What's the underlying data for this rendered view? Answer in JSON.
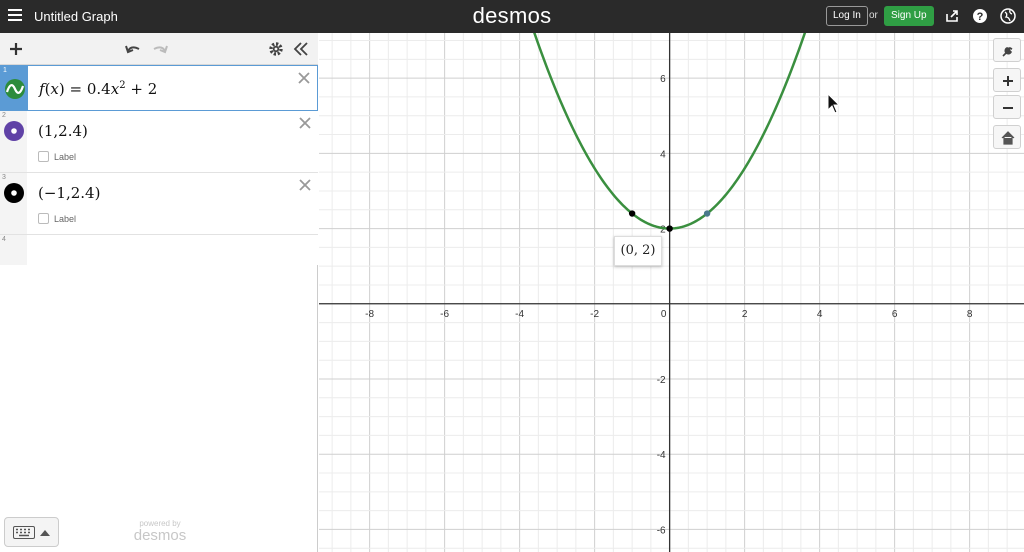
{
  "header": {
    "doc_title": "Untitled Graph",
    "brand": "desmos",
    "login_label": "Log In",
    "or_label": "or",
    "signup_label": "Sign Up",
    "icons": [
      "share-icon",
      "help-icon",
      "language-globe-icon"
    ]
  },
  "toolbar": {
    "icons": [
      "add-icon",
      "undo-icon",
      "redo-icon",
      "settings-gear-icon",
      "collapse-panel-icon"
    ]
  },
  "expressions": [
    {
      "num": "1",
      "latex_parts": {
        "fn": "f",
        "var": "x",
        "eq": "=",
        "coef": "0.4",
        "var2": "x",
        "exp": "2",
        "rest": "+ 2"
      },
      "color": "#2d8c3c",
      "type": "function"
    },
    {
      "num": "2",
      "text": "(1,2.4)",
      "color": "#6042a6",
      "type": "point",
      "label": "Label"
    },
    {
      "num": "3",
      "text": "(−1,2.4)",
      "color": "#000000",
      "type": "point",
      "label": "Label"
    },
    {
      "num": "4"
    }
  ],
  "footer": {
    "powered_small": "powered by",
    "powered_big": "desmos"
  },
  "graph": {
    "tooltip": "(0, 2)",
    "x_ticks": [
      "-8",
      "-6",
      "-4",
      "-2",
      "0",
      "2",
      "4",
      "6",
      "8"
    ],
    "y_ticks": [
      "6",
      "4",
      "2",
      "-2",
      "-4",
      "-6"
    ],
    "curve_color": "#3a8f3f",
    "tools": [
      "wrench-icon",
      "zoom-in-icon",
      "zoom-out-icon",
      "home-icon"
    ]
  },
  "chart_data": {
    "type": "line",
    "function": "f(x) = 0.4x^2 + 2",
    "coef": 0.4,
    "offset": 2,
    "x_range": [
      -9.35,
      9.45
    ],
    "y_range": [
      -6.6,
      7.2
    ],
    "points": [
      {
        "x": 1,
        "y": 2.4,
        "color": "#4a7a8c"
      },
      {
        "x": -1,
        "y": 2.4,
        "color": "#000000"
      },
      {
        "x": 0,
        "y": 2,
        "color": "#000000"
      }
    ],
    "x_ticks": [
      -8,
      -6,
      -4,
      -2,
      2,
      4,
      6,
      8
    ],
    "y_ticks": [
      -6,
      -4,
      -2,
      2,
      4,
      6
    ]
  }
}
